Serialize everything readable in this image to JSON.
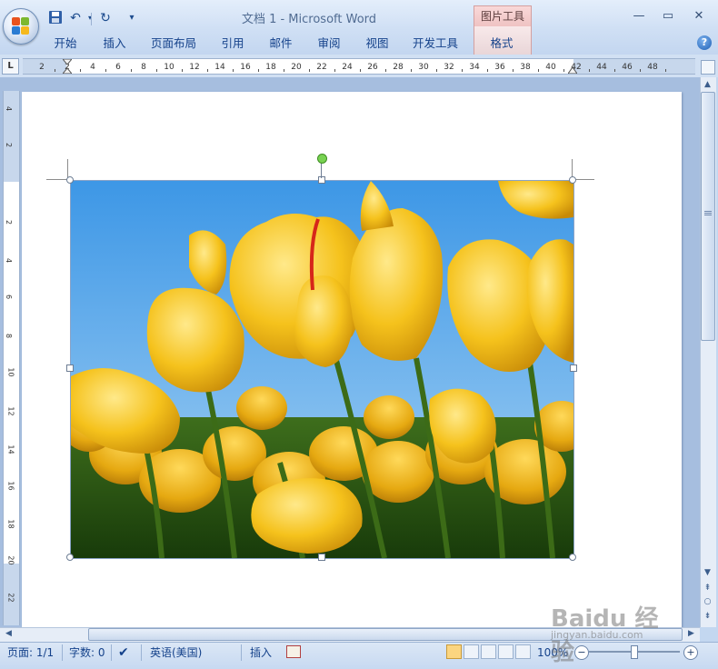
{
  "window": {
    "title": "文档 1 - Microsoft Word",
    "contextual_group": "图片工具"
  },
  "ribbon": {
    "tabs": [
      "开始",
      "插入",
      "页面布局",
      "引用",
      "邮件",
      "审阅",
      "视图",
      "开发工具",
      "格式"
    ],
    "active_tab": "格式"
  },
  "quick_access": {
    "save_icon": "save-icon",
    "undo_icon": "undo-icon",
    "redo_icon": "redo-icon",
    "customize_icon": "customize-qat-icon"
  },
  "ruler": {
    "h_labels": [
      "2",
      "2",
      "4",
      "6",
      "8",
      "10",
      "12",
      "14",
      "16",
      "18",
      "20",
      "22",
      "24",
      "26",
      "28",
      "30",
      "32",
      "34",
      "36",
      "38",
      "40",
      "42",
      "44",
      "46",
      "48"
    ],
    "v_labels": [
      "4",
      "2",
      "2",
      "4",
      "6",
      "8",
      "10",
      "12",
      "14",
      "16",
      "18",
      "20",
      "22"
    ],
    "tab_selector": "L"
  },
  "picture": {
    "subject": "",
    "selected": true
  },
  "status_bar": {
    "page": "页面: 1/1",
    "words": "字数: 0",
    "language": "英语(美国)",
    "mode": "插入",
    "zoom": "100%"
  },
  "watermark": {
    "logo": "Baidu 经验",
    "url": "jingyan.baidu.com"
  },
  "colors": {
    "ribbon": "#cfdff4",
    "context_tab": "#f3cfcf",
    "doc_bg": "#a6bedf",
    "accent_text": "#15428b"
  }
}
